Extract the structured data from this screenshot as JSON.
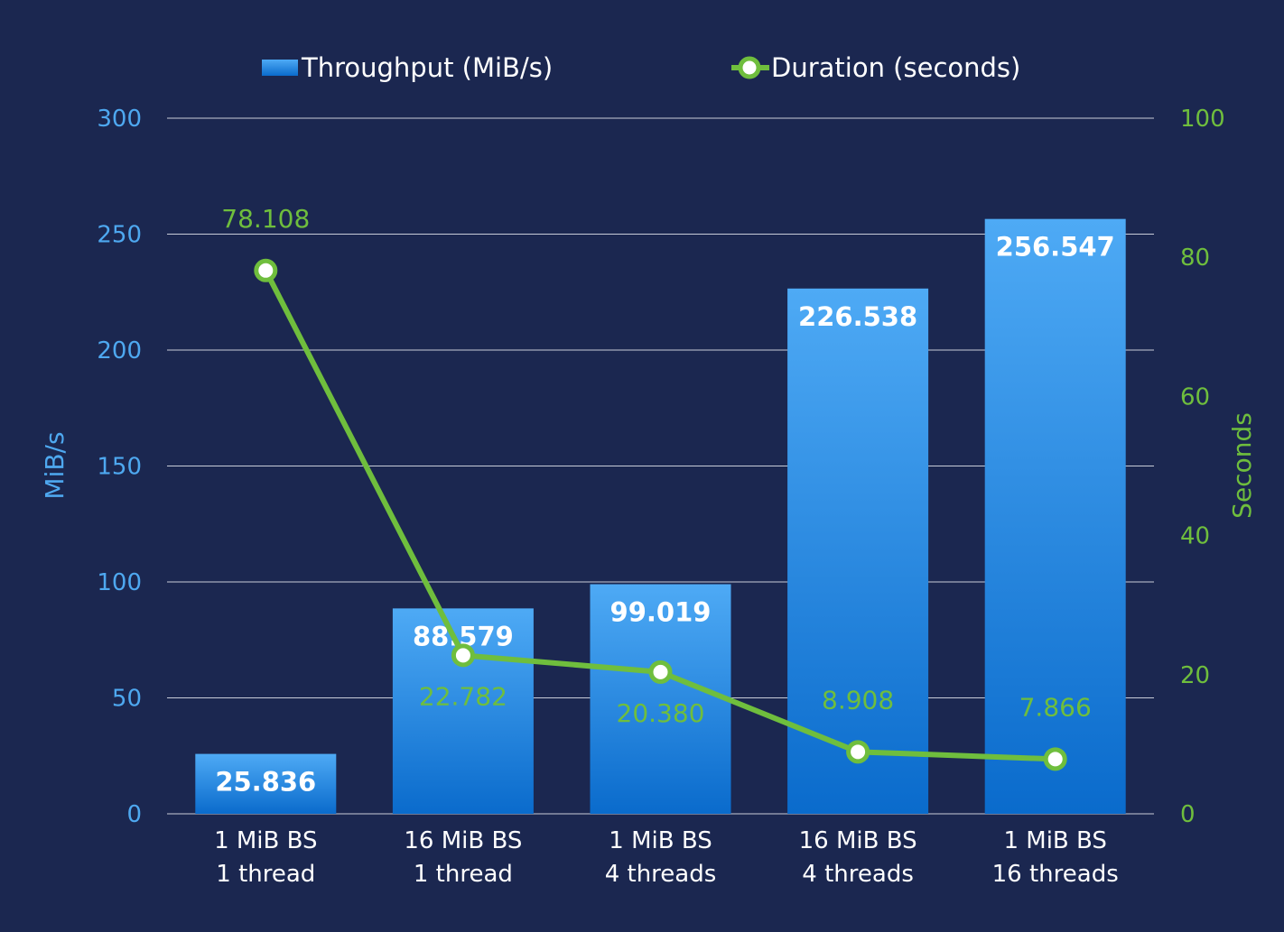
{
  "chart_data": {
    "type": "bar",
    "categories": [
      [
        "1 MiB BS",
        "1 thread"
      ],
      [
        "16 MiB BS",
        "1 thread"
      ],
      [
        "1 MiB BS",
        "4 threads"
      ],
      [
        "16 MiB BS",
        "4 threads"
      ],
      [
        "1 MiB BS",
        "16 threads"
      ]
    ],
    "series": [
      {
        "name": "Throughput (MiB/s)",
        "type": "bar",
        "axis": "left",
        "values": [
          25.836,
          88.579,
          99.019,
          226.538,
          256.547
        ],
        "labels": [
          "25.836",
          "88.579",
          "99.019",
          "226.538",
          "256.547"
        ],
        "color_top": "#4eaaf5",
        "color_bottom": "#0a6bcc"
      },
      {
        "name": "Duration (seconds)",
        "type": "line",
        "axis": "right",
        "values": [
          78.108,
          22.782,
          20.38,
          8.908,
          7.866
        ],
        "labels": [
          "78.108",
          "22.782",
          "20.380",
          "8.908",
          "7.866"
        ],
        "color": "#6fbe3d"
      }
    ],
    "ylabel": "MiB/s",
    "y2label": "Seconds",
    "ylim": [
      0,
      300
    ],
    "y2lim": [
      0,
      100
    ],
    "yticks": [
      0,
      50,
      100,
      150,
      200,
      250,
      300
    ],
    "y2ticks": [
      0,
      20,
      40,
      60,
      80,
      100
    ],
    "grid": true,
    "legend_position": "top-center",
    "colors": {
      "background": "#1b2750",
      "left_axis_text": "#4ea8f0",
      "right_axis_text": "#6fbe3d",
      "category_text": "#ffffff",
      "bar_label": "#ffffff",
      "grid": "#c8ccd8"
    }
  }
}
